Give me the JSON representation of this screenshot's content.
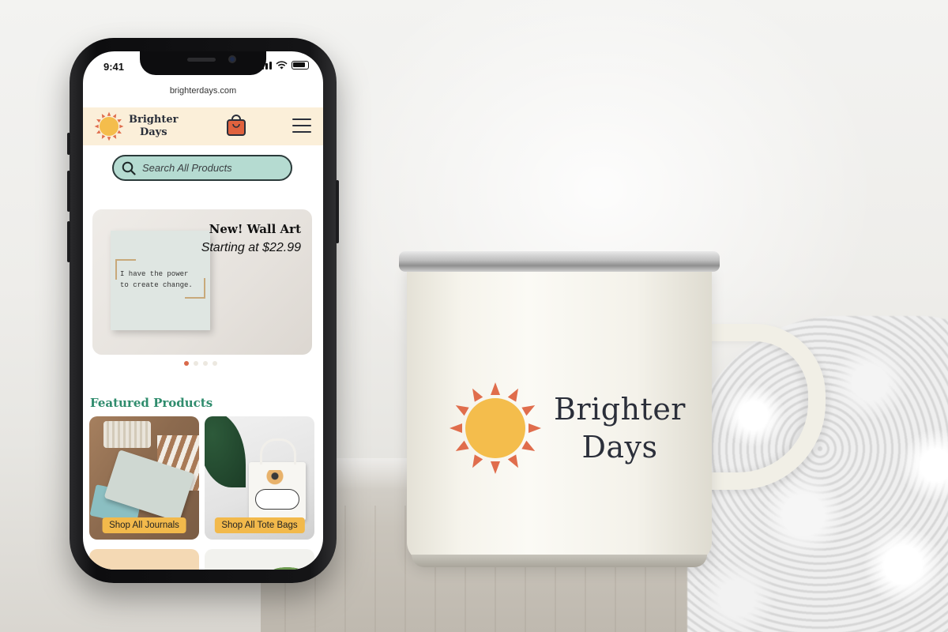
{
  "status_bar": {
    "time": "9:41"
  },
  "browser": {
    "url": "brighterdays.com"
  },
  "header": {
    "brand_line1": "Brighter",
    "brand_line2": "Days",
    "cart_icon": "shopping-bag-icon",
    "menu_icon": "hamburger-menu-icon"
  },
  "search": {
    "placeholder": "Search All Products"
  },
  "hero": {
    "title": "New! Wall Art",
    "subtitle": "Starting at $22.99",
    "art_quote_line1": "I have the power",
    "art_quote_line2": "to create change.",
    "carousel_pages": 4,
    "carousel_active": 1
  },
  "featured": {
    "title": "Featured Products",
    "cards": [
      {
        "button": "Shop All Journals"
      },
      {
        "button": "Shop All Tote Bags"
      }
    ]
  },
  "mug": {
    "brand_line1": "Brighter",
    "brand_line2": "Days"
  },
  "colors": {
    "sun_fill": "#f4bd4c",
    "sun_rays": "#e06d4c",
    "header_bg": "#fbefd9",
    "search_bg": "#b5dbd1",
    "accent_green": "#2f8c6d",
    "button_yellow": "#f2b94b",
    "cart_orange": "#e0623e"
  }
}
